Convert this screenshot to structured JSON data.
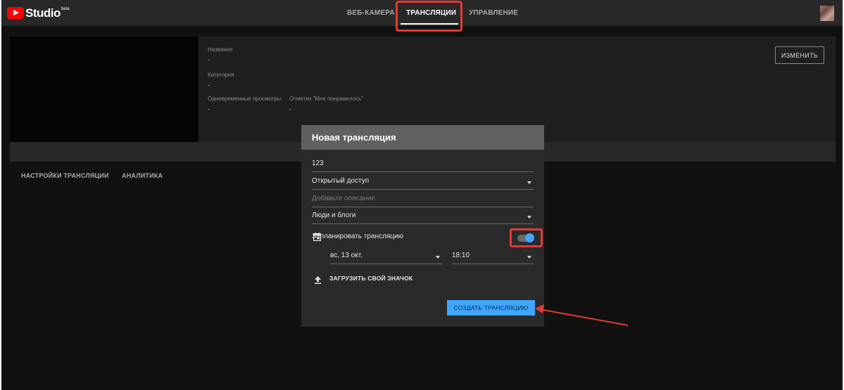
{
  "app": {
    "logo_text": "Studio",
    "logo_badge": "beta"
  },
  "nav": {
    "tabs": [
      {
        "label": "ВЕБ-КАМЕРА",
        "active": false
      },
      {
        "label": "ТРАНСЛЯЦИИ",
        "active": true
      },
      {
        "label": "УПРАВЛЕНИЕ",
        "active": false
      }
    ]
  },
  "info": {
    "title_label": "Название",
    "title_value": "-",
    "category_label": "Категория",
    "category_value": "-",
    "viewers_label": "Одновременные просмотры",
    "viewers_value": "-",
    "likes_label": "Отметки \"Мне понравилось\"",
    "likes_value": "-",
    "edit_label": "ИЗМЕНИТЬ"
  },
  "subtabs": [
    {
      "label": "НАСТРОЙКИ ТРАНСЛЯЦИИ"
    },
    {
      "label": "АНАЛИТИКА"
    }
  ],
  "dialog": {
    "title": "Новая трансляция",
    "name_value": "123",
    "privacy_value": "Открытый доступ",
    "description_placeholder": "Добавьте описание",
    "category_value": "Люди и блоги",
    "schedule_label": "Запланировать трансляцию",
    "schedule_enabled": true,
    "date_value": "вс, 13 окт.",
    "time_value": "18:10",
    "upload_label": "ЗАГРУЗИТЬ СВОЙ ЗНАЧОК",
    "create_label": "СОЗДАТЬ ТРАНСЛЯЦИЮ"
  },
  "colors": {
    "accent": "#3ea6ff",
    "highlight": "#e53935",
    "brand_red": "#ff0000",
    "background": "#111111",
    "dialog_header": "#606060",
    "dialog_body": "#2a2a2a"
  }
}
